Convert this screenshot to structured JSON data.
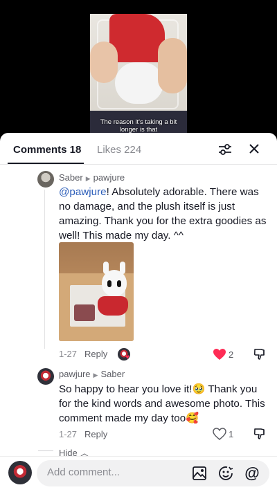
{
  "video": {
    "caption": "The reason it's taking a bit longer is that"
  },
  "tabs": {
    "comments_label": "Comments 18",
    "likes_label": "Likes 224"
  },
  "comments": [
    {
      "author": "Saber",
      "reply_to": "pawjure",
      "mention": "@pawjure",
      "text": "! Absolutely adorable. There was no damage, and the plush itself is just amazing. Thank you for the extra goodies as well! This made my day. ^^",
      "date": "1-27",
      "reply_label": "Reply",
      "likes": "2",
      "liked": true,
      "creator_liked": true
    },
    {
      "author": "pawjure",
      "reply_to": "Saber",
      "text": "So happy to hear you love it!🥹 Thank you for the kind words and awesome photo. This comment made my day too🥰",
      "date": "1-27",
      "reply_label": "Reply",
      "likes": "1",
      "liked": false
    }
  ],
  "hide_label": "Hide",
  "composer": {
    "placeholder": "Add comment..."
  },
  "colors": {
    "accent_red": "#fe2c55",
    "mention_blue": "#2b5db9"
  },
  "icons": [
    "filter-sliders-icon",
    "close-icon",
    "heart-icon",
    "dislike-icon",
    "image-icon",
    "emoji-icon",
    "at-mention-icon"
  ]
}
